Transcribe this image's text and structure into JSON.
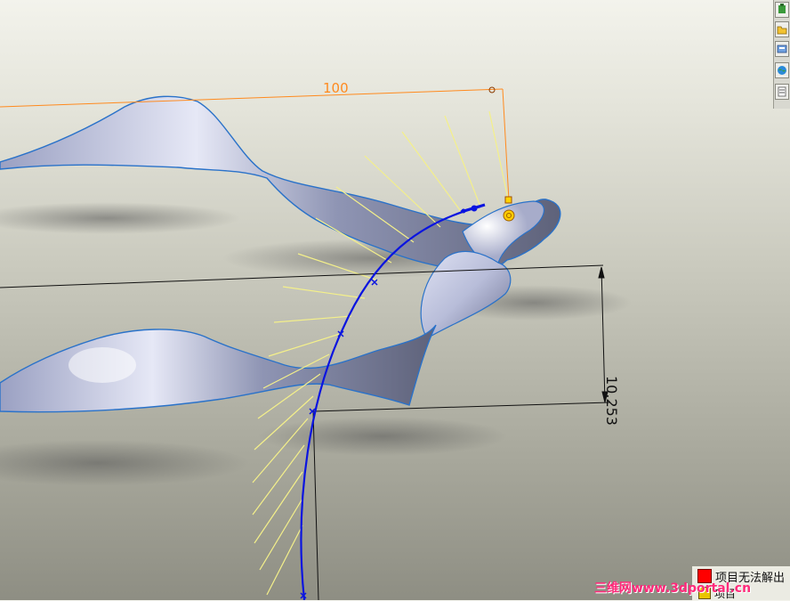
{
  "dimensions": {
    "horizontal_value": "100",
    "vertical_value": "10.253"
  },
  "status": {
    "error_message": "项目无法解出",
    "second_message": "项目"
  },
  "watermark": {
    "text": "三维网www.3dportal.cn"
  },
  "colors": {
    "curve": "#0a14e0",
    "dimension_horizontal": "#ff8a1e",
    "dimension_vertical": "#111111",
    "curvature_comb": "#f2ef8c",
    "surface": "#c4c9e6",
    "error": "#ff0000"
  },
  "taskpane": {
    "icons": [
      "resources-icon",
      "folder-icon",
      "library-icon",
      "explorer-icon",
      "properties-icon"
    ]
  }
}
